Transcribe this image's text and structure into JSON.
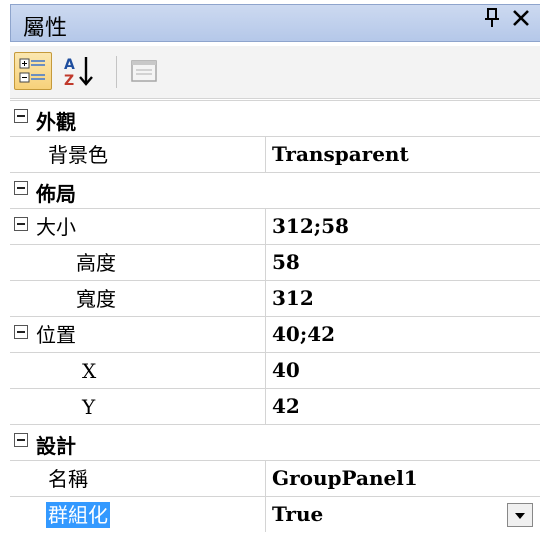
{
  "panel": {
    "title": "屬性",
    "pin_icon": "pin-icon",
    "close_icon": "close-icon"
  },
  "toolbar": {
    "buttons": [
      {
        "icon": "categorized-icon",
        "active": true
      },
      {
        "icon": "sort-alphabetical-icon",
        "active": false
      },
      {
        "icon": "property-pages-icon",
        "active": false
      }
    ]
  },
  "categories": [
    {
      "label": "外觀"
    },
    {
      "label": "佈局"
    },
    {
      "label": "設計"
    }
  ],
  "properties": {
    "background_color": {
      "label": "背景色",
      "value": "Transparent"
    },
    "size": {
      "label": "大小",
      "value": "312;58"
    },
    "height": {
      "label": "高度",
      "value": "58"
    },
    "width": {
      "label": "寬度",
      "value": "312"
    },
    "location": {
      "label": "位置",
      "value": "40;42"
    },
    "x": {
      "label": "X",
      "value": "40"
    },
    "y": {
      "label": "Y",
      "value": "42"
    },
    "name": {
      "label": "名稱",
      "value": "GroupPanel1"
    },
    "grouping": {
      "label": "群組化",
      "value": "True"
    }
  },
  "colors": {
    "title_bar": "#b5c8e9",
    "selection": "#3399ff",
    "grid_line": "#d4d4d4"
  }
}
